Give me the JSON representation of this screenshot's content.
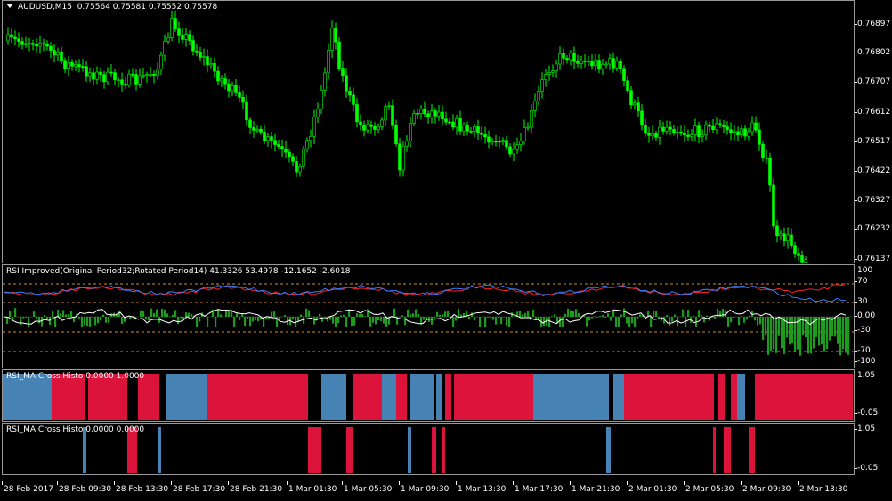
{
  "main": {
    "menu_icon": "triangle-down-icon",
    "symbol": "AUDUSD,M15",
    "ohlc": "0.75564 0.75581 0.75552 0.75578",
    "price_ticks": [
      "0.76897",
      "0.76802",
      "0.76707",
      "0.76612",
      "0.76517",
      "0.76422",
      "0.76327",
      "0.76232",
      "0.76137"
    ],
    "candle_color": "#00ff00"
  },
  "rsi": {
    "title": "RSI Improved(Original Period32;Rotated Period14) 41.3326 53.4978 -12.1652 -2.6018",
    "ticks": [
      "100",
      "70",
      "30",
      "0.00",
      "-30",
      "-70",
      "-100"
    ],
    "colors": {
      "red_line": "#ff2020",
      "blue_line": "#3c7dff",
      "white_line": "#ffffff",
      "histogram": "#1e9b1e",
      "levels": "#d28c28"
    }
  },
  "histo1": {
    "title": "RSI_MA Cross Histo 0.0000 1.0000",
    "ticks": [
      "1.05",
      "-0.05"
    ],
    "colors": {
      "red": "#dc143c",
      "blue": "#4682b4"
    }
  },
  "histo2": {
    "title": "RSI_MA Cross Histo 0.0000 0.0000",
    "ticks": [
      "1.05",
      "-0.05"
    ]
  },
  "time_ticks": [
    "28 Feb 2017",
    "28 Feb 09:30",
    "28 Feb 13:30",
    "28 Feb 17:30",
    "28 Feb 21:30",
    "1 Mar 01:30",
    "1 Mar 05:30",
    "1 Mar 09:30",
    "1 Mar 13:30",
    "1 Mar 17:30",
    "1 Mar 21:30",
    "2 Mar 01:30",
    "2 Mar 05:30",
    "2 Mar 09:30",
    "2 Mar 13:30"
  ]
}
